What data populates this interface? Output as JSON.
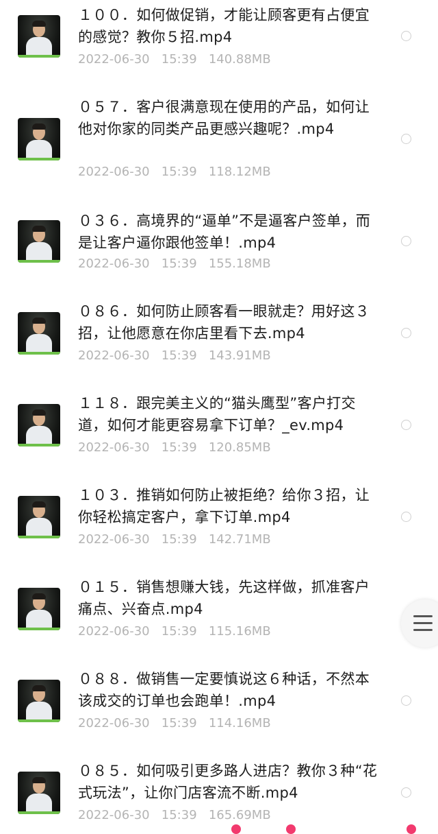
{
  "files": [
    {
      "title": "１００．如何做促销，才能让顾客更有占便宜的感觉？教你５招.mp4",
      "date": "2022-06-30",
      "time": "15:39",
      "size": "140.88MB"
    },
    {
      "title": "０５７．客户很满意现在使用的产品，如何让他对你家的同类产品更感兴趣呢？.mp4",
      "date": "2022-06-30",
      "time": "15:39",
      "size": "118.12MB"
    },
    {
      "title": "０３６．高境界的“逼单”不是逼客户签单，而是让客户逼你跟他签单！.mp4",
      "date": "2022-06-30",
      "time": "15:39",
      "size": "155.18MB"
    },
    {
      "title": "０８６．如何防止顾客看一眼就走？用好这３招，让他愿意在你店里看下去.mp4",
      "date": "2022-06-30",
      "time": "15:39",
      "size": "143.91MB"
    },
    {
      "title": "１１８．跟完美主义的“猫头鹰型”客户打交道，如何才能更容易拿下订单？_ev.mp4",
      "date": "2022-06-30",
      "time": "15:39",
      "size": "120.85MB"
    },
    {
      "title": "１０３．推销如何防止被拒绝？给你３招，让你轻松搞定客户，拿下订单.mp4",
      "date": "2022-06-30",
      "time": "15:39",
      "size": "142.71MB"
    },
    {
      "title": "０１５．销售想赚大钱，先这样做，抓准客户痛点、兴奋点.mp4",
      "date": "2022-06-30",
      "time": "15:39",
      "size": "115.16MB"
    },
    {
      "title": "０８８．做销售一定要慎说这６种话，不然本该成交的订单也会跑单！.mp4",
      "date": "2022-06-30",
      "time": "15:39",
      "size": "114.16MB"
    },
    {
      "title": "０８５．如何吸引更多路人进店？教你３种“花式玩法”，让你门店客流不断.mp4",
      "date": "2022-06-30",
      "time": "15:39",
      "size": "165.69MB"
    }
  ],
  "icons": {
    "menu": "hamburger-menu-icon",
    "select": "radio-circle-icon"
  },
  "colors": {
    "title": "#1d1d1d",
    "meta": "#b4b4b4",
    "accent": "#f23a6e"
  }
}
